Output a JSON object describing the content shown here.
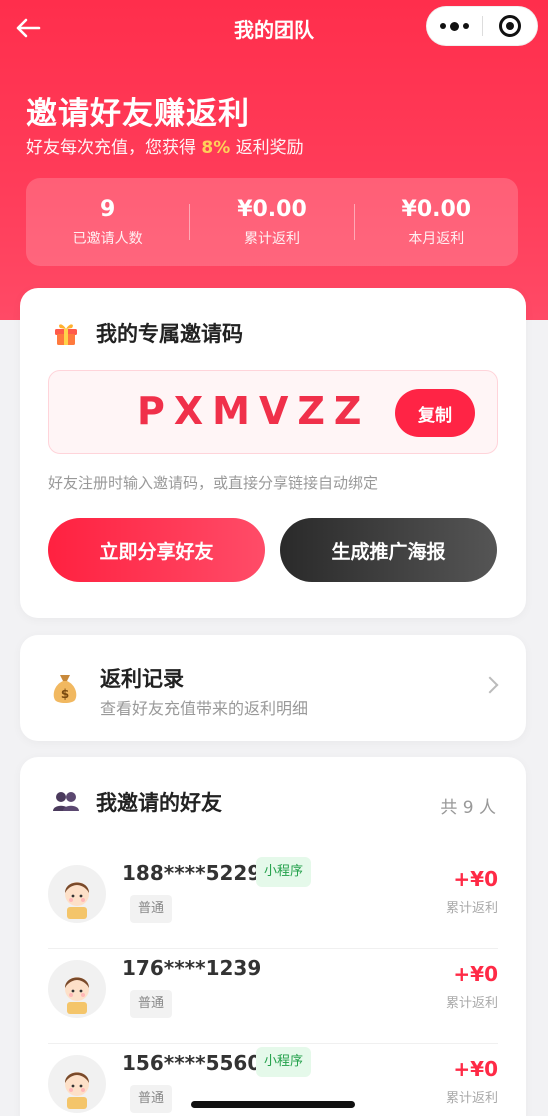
{
  "nav": {
    "title": "我的团队"
  },
  "hero": {
    "title": "邀请好友赚返利",
    "subtitle_prefix": "好友每次充值，您获得",
    "subtitle_pct": "8%",
    "subtitle_suffix": "返利奖励"
  },
  "stats": [
    {
      "value": "9",
      "label": "已邀请人数"
    },
    {
      "value": "¥0.00",
      "label": "累计返利"
    },
    {
      "value": "¥0.00",
      "label": "本月返利"
    }
  ],
  "invite": {
    "title": "我的专属邀请码",
    "code": "PXMVZZ",
    "copy_label": "复制",
    "hint": "好友注册时输入邀请码，或直接分享链接自动绑定",
    "share_label": "立即分享好友",
    "poster_label": "生成推广海报"
  },
  "rebate": {
    "title": "返利记录",
    "subtitle": "查看好友充值带来的返利明细"
  },
  "friends": {
    "title": "我邀请的好友",
    "count": "共 9 人",
    "list": [
      {
        "phone": "188****5229",
        "tag": "小程序",
        "level": "普通",
        "amount": "+¥0",
        "amount_label": "累计返利"
      },
      {
        "phone": "176****1239",
        "tag": "",
        "level": "普通",
        "amount": "+¥0",
        "amount_label": "累计返利"
      },
      {
        "phone": "156****5560",
        "tag": "小程序",
        "level": "普通",
        "amount": "+¥0",
        "amount_label": "累计返利"
      }
    ]
  },
  "colors": {
    "brand": "#ff2e4c",
    "highlight": "#ffd95a",
    "mini_tag": "#22a04a"
  },
  "icons": [
    "back-arrow-icon",
    "more-icon",
    "target-icon",
    "gift-icon",
    "money-bag-icon",
    "chevron-right-icon",
    "users-icon",
    "avatar-icon"
  ]
}
